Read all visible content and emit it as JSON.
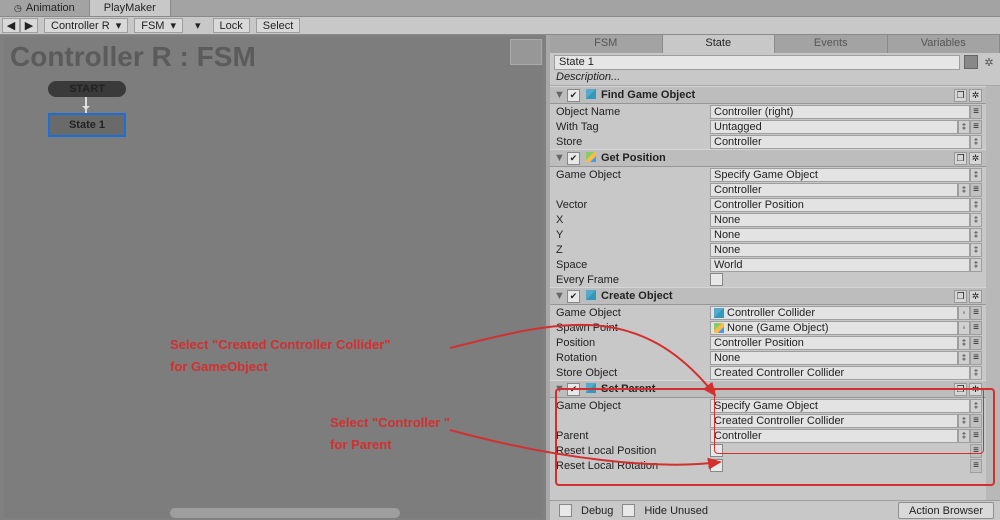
{
  "tabs": {
    "animation": "Animation",
    "playmaker": "PlayMaker"
  },
  "toolbar": {
    "back": "◀",
    "fwd": "▶",
    "dd1": "Controller R",
    "dd2": "FSM",
    "lock": "Lock",
    "select": "Select"
  },
  "canvas": {
    "title": "Controller R : FSM",
    "start": "START",
    "state": "State 1"
  },
  "anno": {
    "l1": "Select \"Created Controller Collider\"",
    "l2": "for GameObject",
    "l3": "Select \"Controller \"",
    "l4": "for Parent"
  },
  "insp_tabs": {
    "fsm": "FSM",
    "state": "State",
    "events": "Events",
    "vars": "Variables"
  },
  "state_name": "State 1",
  "desc_placeholder": "Description...",
  "a1": {
    "title": "Find Game Object",
    "objName": "Object Name",
    "objVal": "Controller (right)",
    "tag": "With Tag",
    "tagVal": "Untagged",
    "store": "Store",
    "storeVal": "Controller"
  },
  "a2": {
    "title": "Get Position",
    "go": "Game Object",
    "goVal": "Specify Game Object",
    "goVar": "Controller",
    "vec": "Vector",
    "vecVal": "Controller Position",
    "x": "X",
    "xv": "None",
    "y": "Y",
    "yv": "None",
    "z": "Z",
    "zv": "None",
    "space": "Space",
    "spaceVal": "World",
    "ef": "Every Frame"
  },
  "a3": {
    "title": "Create Object",
    "go": "Game Object",
    "goVal": "Controller Collider",
    "sp": "Spawn Point",
    "spVal": "None (Game Object)",
    "pos": "Position",
    "posVal": "Controller Position",
    "rot": "Rotation",
    "rotVal": "None",
    "store": "Store Object",
    "storeVal": "Created Controller Collider"
  },
  "a4": {
    "title": "Set Parent",
    "go": "Game Object",
    "goVal": "Specify Game Object",
    "goVar": "Created Controller Collider",
    "parent": "Parent",
    "parentVal": "Controller",
    "rlp": "Reset Local Position",
    "rlr": "Reset Local Rotation"
  },
  "footer": {
    "debug": "Debug",
    "hide": "Hide Unused",
    "ab": "Action Browser"
  }
}
